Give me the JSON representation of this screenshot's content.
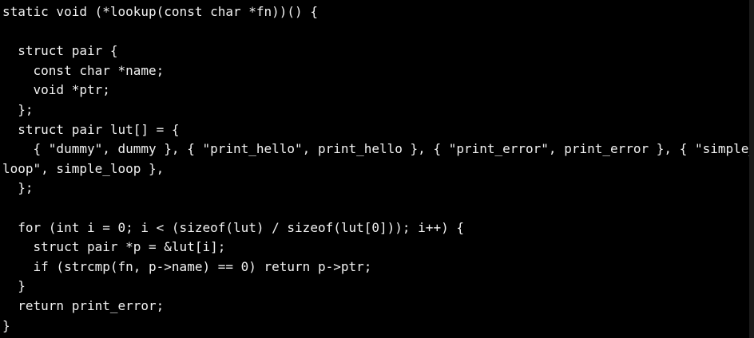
{
  "code": {
    "lines": [
      "static void (*lookup(const char *fn))() {",
      "",
      "  struct pair {",
      "    const char *name;",
      "    void *ptr;",
      "  };",
      "  struct pair lut[] = {",
      "    { \"dummy\", dummy }, { \"print_hello\", print_hello }, { \"print_error\", print_error }, { \"simple_",
      "loop\", simple_loop },",
      "  };",
      "",
      "  for (int i = 0; i < (sizeof(lut) / sizeof(lut[0])); i++) {",
      "    struct pair *p = &lut[i];",
      "    if (strcmp(fn, p->name) == 0) return p->ptr;",
      "  }",
      "  return print_error;",
      "}"
    ]
  },
  "colors": {
    "background": "#000000",
    "text": "#f2f2f2"
  }
}
